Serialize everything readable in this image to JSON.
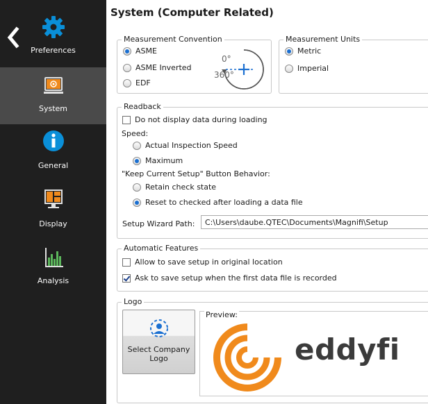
{
  "sidebar": {
    "items": [
      {
        "label": "Preferences",
        "icon": "gear-icon",
        "active": false
      },
      {
        "label": "System",
        "icon": "system-icon",
        "active": true
      },
      {
        "label": "General",
        "icon": "info-icon",
        "active": false
      },
      {
        "label": "Display",
        "icon": "display-icon",
        "active": false
      },
      {
        "label": "Analysis",
        "icon": "analysis-chart-icon",
        "active": false
      }
    ],
    "accent_color": "#0a8fd8"
  },
  "main": {
    "title": "System (Computer Related)",
    "measurement_convention": {
      "legend": "Measurement Convention",
      "options": [
        "ASME",
        "ASME Inverted",
        "EDF"
      ],
      "selected": "ASME",
      "dial_zero": "0°",
      "dial_360": "360°"
    },
    "measurement_units": {
      "legend": "Measurement Units",
      "options": [
        "Metric",
        "Imperial"
      ],
      "selected": "Metric"
    },
    "readback": {
      "legend": "Readback",
      "no_display_label": "Do not display data during loading",
      "no_display_checked": false,
      "speed_label": "Speed:",
      "speed_options": [
        "Actual Inspection Speed",
        "Maximum"
      ],
      "speed_selected": "Maximum",
      "keep_setup_label": "\"Keep Current Setup\" Button Behavior:",
      "keep_setup_options": [
        "Retain check state",
        "Reset to checked after loading a data file"
      ],
      "keep_setup_selected": "Reset to checked after loading a data file",
      "wizard_path_label": "Setup Wizard Path:",
      "wizard_path_value": "C:\\Users\\daube.QTEC\\Documents\\Magnifi\\Setup"
    },
    "automatic_features": {
      "legend": "Automatic Features",
      "allow_save_label": "Allow to save setup in original location",
      "allow_save_checked": false,
      "ask_save_label": "Ask to save setup when the first data file is recorded",
      "ask_save_checked": true
    },
    "logo": {
      "legend": "Logo",
      "select_button_label": "Select Company Logo",
      "preview_label": "Preview:",
      "brand_text": "eddyfi",
      "brand_color": "#f08a1c"
    }
  }
}
